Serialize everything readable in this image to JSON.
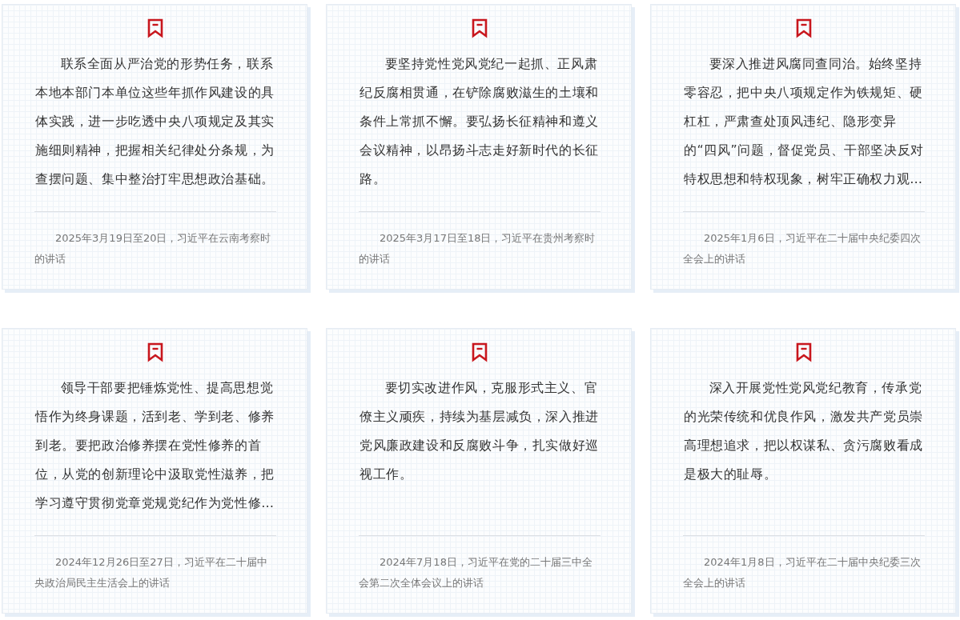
{
  "cards": [
    {
      "quote": "联系全面从严治党的形势任务，联系本地本部门本单位这些年抓作风建设的具体实践，进一步吃透中央八项规定及其实施细则精神，把握相关纪律处分条规，为查摆问题、集中整治打牢思想政治基础。",
      "source": "2025年3月19日至20日，习近平在云南考察时的讲话"
    },
    {
      "quote": "要坚持党性党风党纪一起抓、正风肃纪反腐相贯通，在铲除腐败滋生的土壤和条件上常抓不懈。要弘扬长征精神和遵义会议精神，以昂扬斗志走好新时代的长征路。",
      "source": "2025年3月17日至18日，习近平在贵州考察时的讲话"
    },
    {
      "quote": "要深入推进风腐同查同治。始终坚持零容忍，把中央八项规定作为铁规矩、硬杠杠，严肃查处顶风违纪、隐形变异的“四风”问题，督促党员、干部坚决反对特权思想和特权现象，树牢正确权力观…",
      "source": "2025年1月6日，习近平在二十届中央纪委四次全会上的讲话"
    },
    {
      "quote": "领导干部要把锤炼党性、提高思想觉悟作为终身课题，活到老、学到老、修养到老。要把政治修养摆在党性修养的首位，从党的创新理论中汲取党性滋养，把学习遵守贯彻党章党规党纪作为党性修…",
      "source": "2024年12月26日至27日，习近平在二十届中央政治局民主生活会上的讲话"
    },
    {
      "quote": "要切实改进作风，克服形式主义、官僚主义顽疾，持续为基层减负，深入推进党风廉政建设和反腐败斗争，扎实做好巡视工作。",
      "source": "2024年7月18日，习近平在党的二十届三中全会第二次全体会议上的讲话"
    },
    {
      "quote": "深入开展党性党风党纪教育，传承党的光荣传统和优良作风，激发共产党员崇高理想追求，把以权谋私、贪污腐败看成是极大的耻辱。",
      "source": "2024年1月8日，习近平在二十届中央纪委三次全会上的讲话"
    }
  ]
}
